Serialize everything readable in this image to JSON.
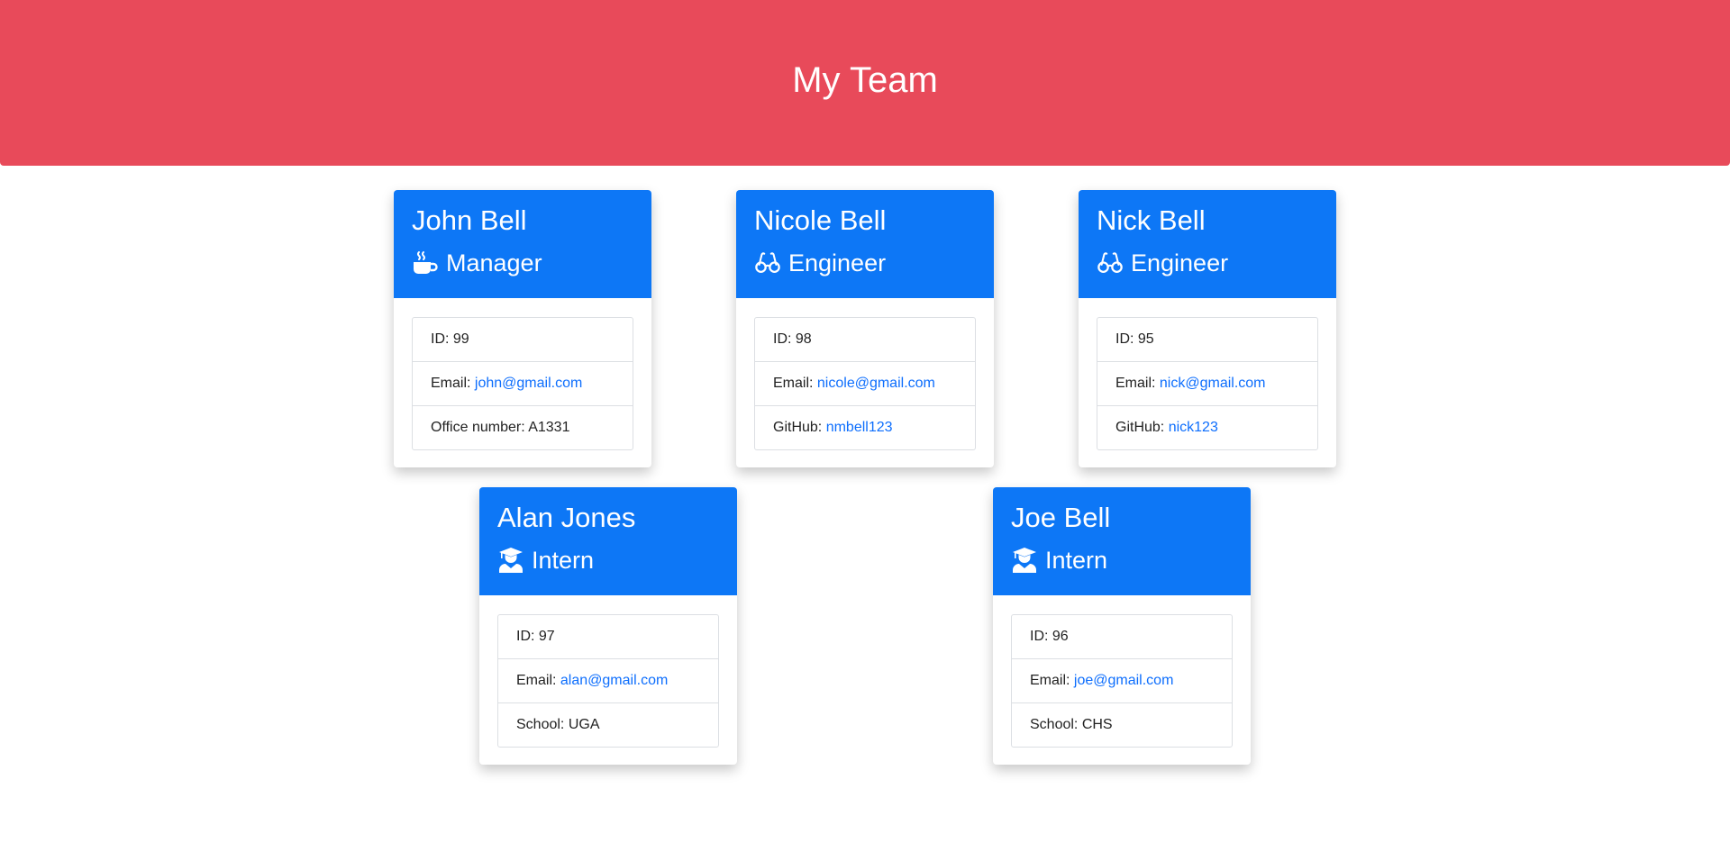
{
  "header": {
    "title": "My Team"
  },
  "colors": {
    "header_bg": "#e84a5a",
    "card_header_bg": "#0d77f6",
    "link": "#0d6efd"
  },
  "employees": [
    {
      "name": "John Bell",
      "role": "Manager",
      "icon": "coffee-mug-icon",
      "id_label": "ID: 99",
      "email_label": "Email:",
      "email": "john@gmail.com",
      "extra_label": "Office number: A1331"
    },
    {
      "name": "Nicole Bell",
      "role": "Engineer",
      "icon": "glasses-icon",
      "id_label": "ID: 98",
      "email_label": "Email:",
      "email": "nicole@gmail.com",
      "extra_label": "GitHub:",
      "extra_link": "nmbell123"
    },
    {
      "name": "Nick Bell",
      "role": "Engineer",
      "icon": "glasses-icon",
      "id_label": "ID: 95",
      "email_label": "Email:",
      "email": "nick@gmail.com",
      "extra_label": "GitHub:",
      "extra_link": "nick123"
    },
    {
      "name": "Alan Jones",
      "role": "Intern",
      "icon": "graduate-icon",
      "id_label": "ID: 97",
      "email_label": "Email:",
      "email": "alan@gmail.com",
      "extra_label": "School: UGA"
    },
    {
      "name": "Joe Bell",
      "role": "Intern",
      "icon": "graduate-icon",
      "id_label": "ID: 96",
      "email_label": "Email:",
      "email": "joe@gmail.com",
      "extra_label": "School: CHS"
    }
  ]
}
